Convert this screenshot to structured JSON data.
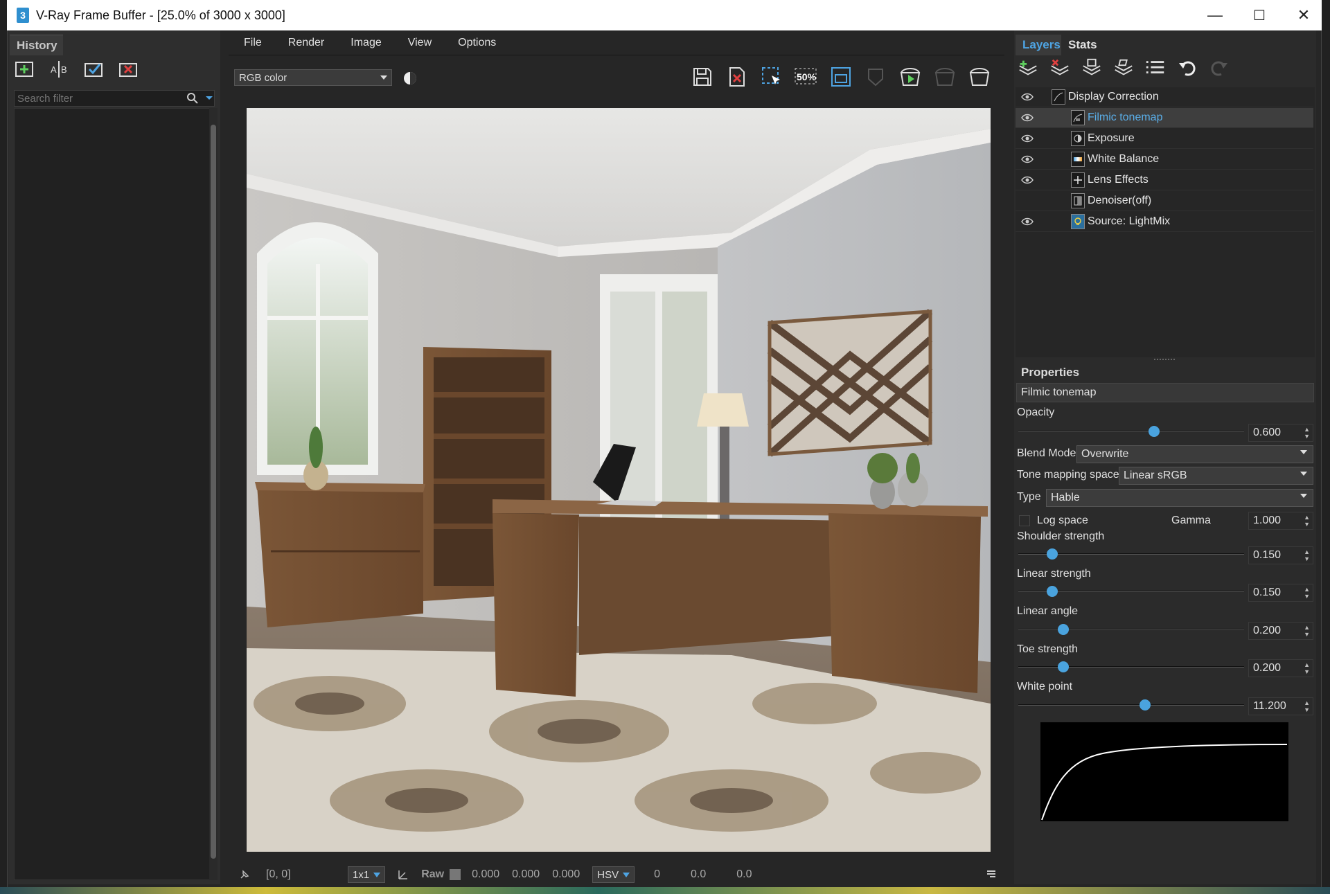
{
  "window": {
    "title": "V-Ray Frame Buffer - [25.0% of 3000 x 3000]",
    "app_icon_label": "3",
    "minimize": "—",
    "maximize": "☐",
    "close": "✕"
  },
  "history": {
    "tab": "History",
    "search_placeholder": "Search filter",
    "icons": [
      "save-to-history-icon",
      "ab-compare-icon",
      "load-history-icon",
      "remove-history-icon"
    ]
  },
  "menu": [
    "File",
    "Render",
    "Image",
    "View",
    "Options"
  ],
  "toolbar": {
    "channel": "RGB color",
    "zoom_label": "50%",
    "icons": [
      "save-image-icon",
      "clear-image-icon",
      "track-mouse-icon",
      "zoom-50-icon",
      "region-render-icon",
      "render-region-icon",
      "start-interactive-icon",
      "stop-render-icon",
      "render-icon"
    ]
  },
  "layers": {
    "tab_active": "Layers",
    "tab_other": "Stats",
    "items": [
      {
        "name": "Display Correction",
        "eye": true,
        "indent": 0,
        "selected": false
      },
      {
        "name": "Filmic tonemap",
        "eye": true,
        "indent": 1,
        "selected": true
      },
      {
        "name": "Exposure",
        "eye": true,
        "indent": 1,
        "selected": false
      },
      {
        "name": "White Balance",
        "eye": true,
        "indent": 1,
        "selected": false
      },
      {
        "name": "Lens Effects",
        "eye": true,
        "indent": 1,
        "selected": false
      },
      {
        "name": "Denoiser(off)",
        "eye": false,
        "indent": 1,
        "selected": false
      },
      {
        "name": "Source: LightMix",
        "eye": true,
        "indent": 1,
        "selected": false
      }
    ]
  },
  "properties": {
    "title": "Properties",
    "layer_name": "Filmic tonemap",
    "opacity": {
      "label": "Opacity",
      "value": "0.600",
      "fraction": 0.6
    },
    "blend_mode": {
      "label": "Blend Mode",
      "value": "Overwrite"
    },
    "tone_mapping_space": {
      "label": "Tone mapping space",
      "value": "Linear sRGB"
    },
    "type": {
      "label": "Type",
      "value": "Hable"
    },
    "log_space": {
      "label": "Log space",
      "checked": false
    },
    "gamma": {
      "label": "Gamma",
      "value": "1.000"
    },
    "shoulder_strength": {
      "label": "Shoulder strength",
      "value": "0.150",
      "fraction": 0.15
    },
    "linear_strength": {
      "label": "Linear strength",
      "value": "0.150",
      "fraction": 0.15
    },
    "linear_angle": {
      "label": "Linear angle",
      "value": "0.200",
      "fraction": 0.2
    },
    "toe_strength": {
      "label": "Toe strength",
      "value": "0.200",
      "fraction": 0.2
    },
    "white_point": {
      "label": "White point",
      "value": "11.200",
      "fraction": 0.56
    }
  },
  "status": {
    "coords": "[0, 0]",
    "sample": "1x1",
    "raw_label": "Raw",
    "r": "0.000",
    "g": "0.000",
    "b": "0.000",
    "colorspace": "HSV",
    "h": "0",
    "s": "0.0",
    "v": "0.0"
  }
}
